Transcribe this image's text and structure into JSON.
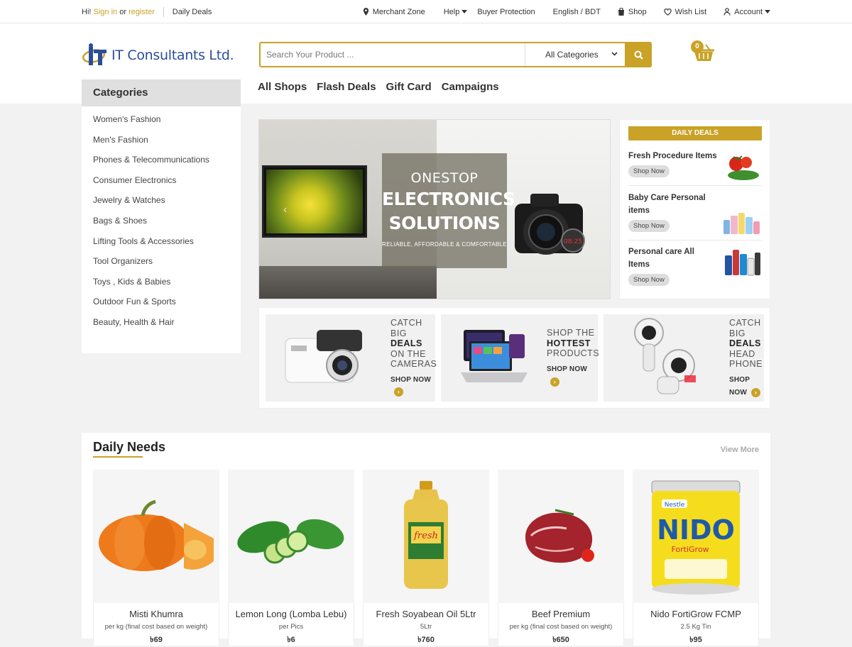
{
  "topbar": {
    "greeting": "Hi!",
    "sign_in": "Sign in",
    "or": "or",
    "register": "register",
    "daily_deals": "Daily Deals",
    "merchant_zone": "Merchant Zone",
    "help": "Help",
    "buyer_protection": "Buyer Protection",
    "language": "English / BDT",
    "shop": "Shop",
    "wish_list": "Wish List",
    "account": "Account"
  },
  "header": {
    "logo_text": "IT Consultants Ltd.",
    "search_placeholder": "Search Your Product ...",
    "category_select": "All Categories",
    "cart_count": "0"
  },
  "nav": [
    "All Shops",
    "Flash Deals",
    "Gift Card",
    "Campaigns"
  ],
  "sidebar": {
    "title": "Categories",
    "items": [
      "Women's Fashion",
      "Men's Fashion",
      "Phones & Telecommunications",
      "Consumer Electronics",
      "Jewelry & Watches",
      "Bags & Shoes",
      "Lifting Tools & Accessories",
      "Tool Organizers",
      "Toys , Kids & Babies",
      "Outdoor Fun & Sports",
      "Beauty, Health & Hair"
    ]
  },
  "banner": {
    "line1": "ONESTOP",
    "line2": "ELECTRONICS",
    "line3": "SOLUTIONS",
    "tagline": "RELIABLE, AFFORDABLE & COMFORTABLE"
  },
  "daily_deals": {
    "title": "DAILY DEALS",
    "items": [
      {
        "name": "Fresh Procedure Items",
        "cta": "Shop Now"
      },
      {
        "name": "Baby Care Personal items",
        "cta": "Shop Now"
      },
      {
        "name": "Personal care All Items",
        "cta": "Shop Now"
      }
    ]
  },
  "promos": [
    {
      "l1": "CATCH",
      "l2": "BIG",
      "l3": "DEALS",
      "l4": "ON THE",
      "l5": "CAMERAS",
      "cta": "SHOP NOW"
    },
    {
      "l1": "SHOP THE",
      "l2": "HOTTEST",
      "l3": "PRODUCTS",
      "cta": "SHOP NOW"
    },
    {
      "l1": "CATCH",
      "l2": "BIG",
      "l3": "DEALS",
      "l4": "HEAD",
      "l5": "PHONE",
      "cta1": "SHOP",
      "cta2": "NOW"
    }
  ],
  "daily_needs": {
    "title": "Daily Needs",
    "view_more": "View More",
    "products": [
      {
        "name": "Misti Khumra",
        "unit": "per kg (final cost based on weight)",
        "price": "৳69"
      },
      {
        "name": "Lemon Long (Lomba Lebu)",
        "unit": "per Pics",
        "price": "৳6"
      },
      {
        "name": "Fresh Soyabean Oil 5Ltr",
        "unit": "5Ltr",
        "price": "৳760"
      },
      {
        "name": "Beef Premium",
        "unit": "per kg (final cost based on weight)",
        "price": "৳650"
      },
      {
        "name": "Nido FortiGrow FCMP",
        "unit": "2.5 Kg Tin",
        "price": "৳95"
      }
    ]
  },
  "colors": {
    "accent": "#c9a227",
    "brand_blue": "#2a4d9b"
  }
}
